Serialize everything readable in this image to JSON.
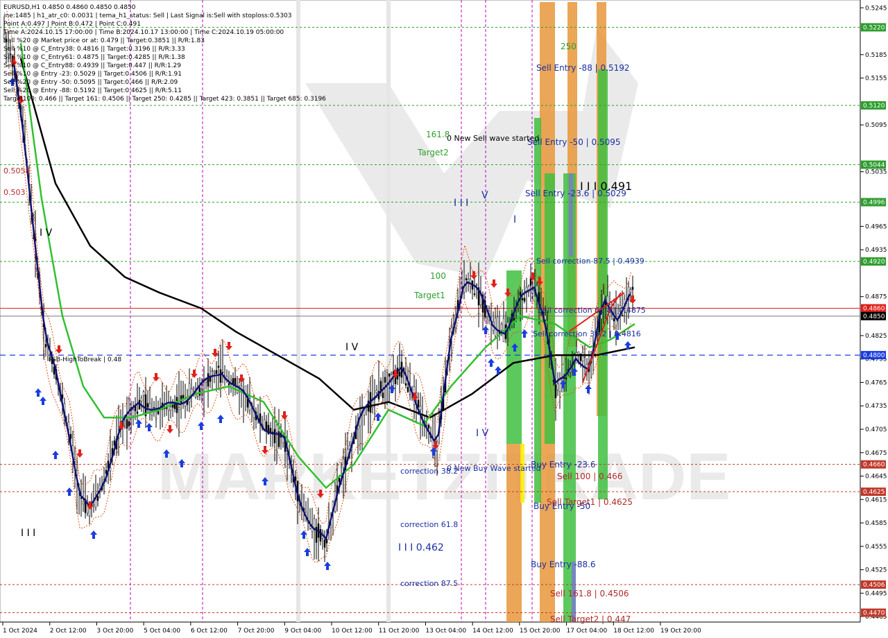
{
  "chart_data": {
    "type": "candlestick",
    "symbol": "EURUSD,H1",
    "ohlc_header": "0.4850 0.4860 0.4850 0.4850",
    "info_lines": [
      "EURUSD,H1  0.4850 0.4860 0.4850 0.4850",
      "ine:1485 | h1_atr_c0: 0.0031 | tema_h1_status: Sell | Last Signal is:Sell with stoploss:0.5303",
      "Point A:0.497 | Point B:0.472 | Point C:0.491",
      "Time A:2024.10.15 17:00:00 | Time B:2024.10.17 13:00:00 | Time C:2024.10.19 05:00:00",
      "Sell %20 @ Market price or at: 0.479 || Target:0.3851 || R/R:1.83",
      "Sell %10 @ C_Entry38: 0.4816 || Target:0.3196 || R/R:3.33",
      "Sell %10 @ C_Entry61: 0.4875 || Target:0.4285 || R/R:1.38",
      "Sell %10 @ C_Entry88: 0.4939 || Target:0.447 || R/R:1.29",
      "Sell %10 @ Entry -23: 0.5029 || Target:0.4506 || R/R:1.91",
      "Sell %20 @ Entry -50: 0.5095 || Target:0.466 || R/R:2.09",
      "Sell %20 @ Entry -88: 0.5192 || Target:0.4625 || R/R:5.11",
      "Target100: 0.466 || Target 161: 0.4506 || Target 250: 0.4285 || Target 423: 0.3851 || Target 685: 0.3196"
    ],
    "y_ticks": [
      "0.5245",
      "0.5185",
      "0.5155",
      "0.5095",
      "0.5035",
      "0.4965",
      "0.4935",
      "0.4875",
      "0.4825",
      "0.4795",
      "0.4765",
      "0.4735",
      "0.4705",
      "0.4675",
      "0.4645",
      "0.4615",
      "0.4585",
      "0.4555",
      "0.4525",
      "0.4495",
      "0.4465"
    ],
    "ylim": [
      0.4458,
      0.5255
    ],
    "x_ticks": [
      "1 Oct 2024",
      "2 Oct 12:00",
      "3 Oct 20:00",
      "5 Oct 04:00",
      "6 Oct 12:00",
      "7 Oct 20:00",
      "9 Oct 04:00",
      "10 Oct 12:00",
      "11 Oct 20:00",
      "13 Oct 04:00",
      "14 Oct 12:00",
      "15 Oct 20:00",
      "17 Oct 04:00",
      "18 Oct 12:00",
      "19 Oct 20:00"
    ],
    "price_tags": [
      {
        "value": "0.5220",
        "color": "#2e9e2e"
      },
      {
        "value": "0.5120",
        "color": "#2e9e2e"
      },
      {
        "value": "0.5044",
        "color": "#2e9e2e"
      },
      {
        "value": "0.4996",
        "color": "#2e9e2e"
      },
      {
        "value": "0.4920",
        "color": "#2e9e2e"
      },
      {
        "value": "0.4860",
        "color": "#e0201b"
      },
      {
        "value": "0.4850",
        "color": "#000000"
      },
      {
        "value": "0.4800",
        "color": "#1a3de0"
      },
      {
        "value": "0.4660",
        "color": "#c0392b"
      },
      {
        "value": "0.4625",
        "color": "#c0392b"
      },
      {
        "value": "0.4506",
        "color": "#c0392b"
      },
      {
        "value": "0.4470",
        "color": "#c0392b"
      }
    ],
    "annotations": [
      {
        "text": "Sell Entry -88 | 0.5192",
        "color": "#1a2fa0"
      },
      {
        "text": "Sell Entry -50 | 0.5095",
        "color": "#1a2fa0"
      },
      {
        "text": "Sell Entry -23.6 | 0.5029",
        "color": "#1a2fa0"
      },
      {
        "text": "Sell correction 87.5 | 0.4939",
        "color": "#1a2fa0"
      },
      {
        "text": "Sell correction 61.8 | 0.4875",
        "color": "#1a2fa0"
      },
      {
        "text": "Sell correction 38.2 | 0.4816",
        "color": "#1a2fa0"
      },
      {
        "text": "Sell 100 | 0.466",
        "color": "#b02a2a"
      },
      {
        "text": "Sell Target1 | 0.4625",
        "color": "#b02a2a"
      },
      {
        "text": "Sell 161.8 | 0.4506",
        "color": "#b02a2a"
      },
      {
        "text": "Sell Target2 | 0.447",
        "color": "#b02a2a"
      },
      {
        "text": "Buy Entry -23.6",
        "color": "#1a2fa0"
      },
      {
        "text": "Buy Entry -50",
        "color": "#1a2fa0"
      },
      {
        "text": "Buy Entry -88.6",
        "color": "#1a2fa0"
      },
      {
        "text": "correction 38.2",
        "color": "#1a2fa0"
      },
      {
        "text": "correction 61.8",
        "color": "#1a2fa0"
      },
      {
        "text": "correction 87.5",
        "color": "#1a2fa0"
      },
      {
        "text": "I I I 0.462",
        "color": "#1a2fa0"
      },
      {
        "text": "I I I 0.491",
        "color": "#000000"
      },
      {
        "text": "0 New Sell wave started",
        "color": "#000000"
      },
      {
        "text": "0 New Buy Wave started",
        "color": "#1a2fa0"
      },
      {
        "text": "FSB-HighToBreak | 0.48",
        "color": "#000000"
      },
      {
        "text": "161.8",
        "color": "#2e9e2e"
      },
      {
        "text": "Target2",
        "color": "#2e9e2e"
      },
      {
        "text": "100",
        "color": "#2e9e2e"
      },
      {
        "text": "Target1",
        "color": "#2e9e2e"
      },
      {
        "text": "250",
        "color": "#2e9e2e"
      },
      {
        "text": "I V",
        "color": "#000000"
      },
      {
        "text": "I I I",
        "color": "#1a2fa0"
      },
      {
        "text": "V",
        "color": "#1a2fa0"
      },
      {
        "text": "0.5058",
        "color": "#b02a2a"
      },
      {
        "text": "0.503",
        "color": "#b02a2a"
      }
    ],
    "watermark": "MARKETZITRADE"
  }
}
